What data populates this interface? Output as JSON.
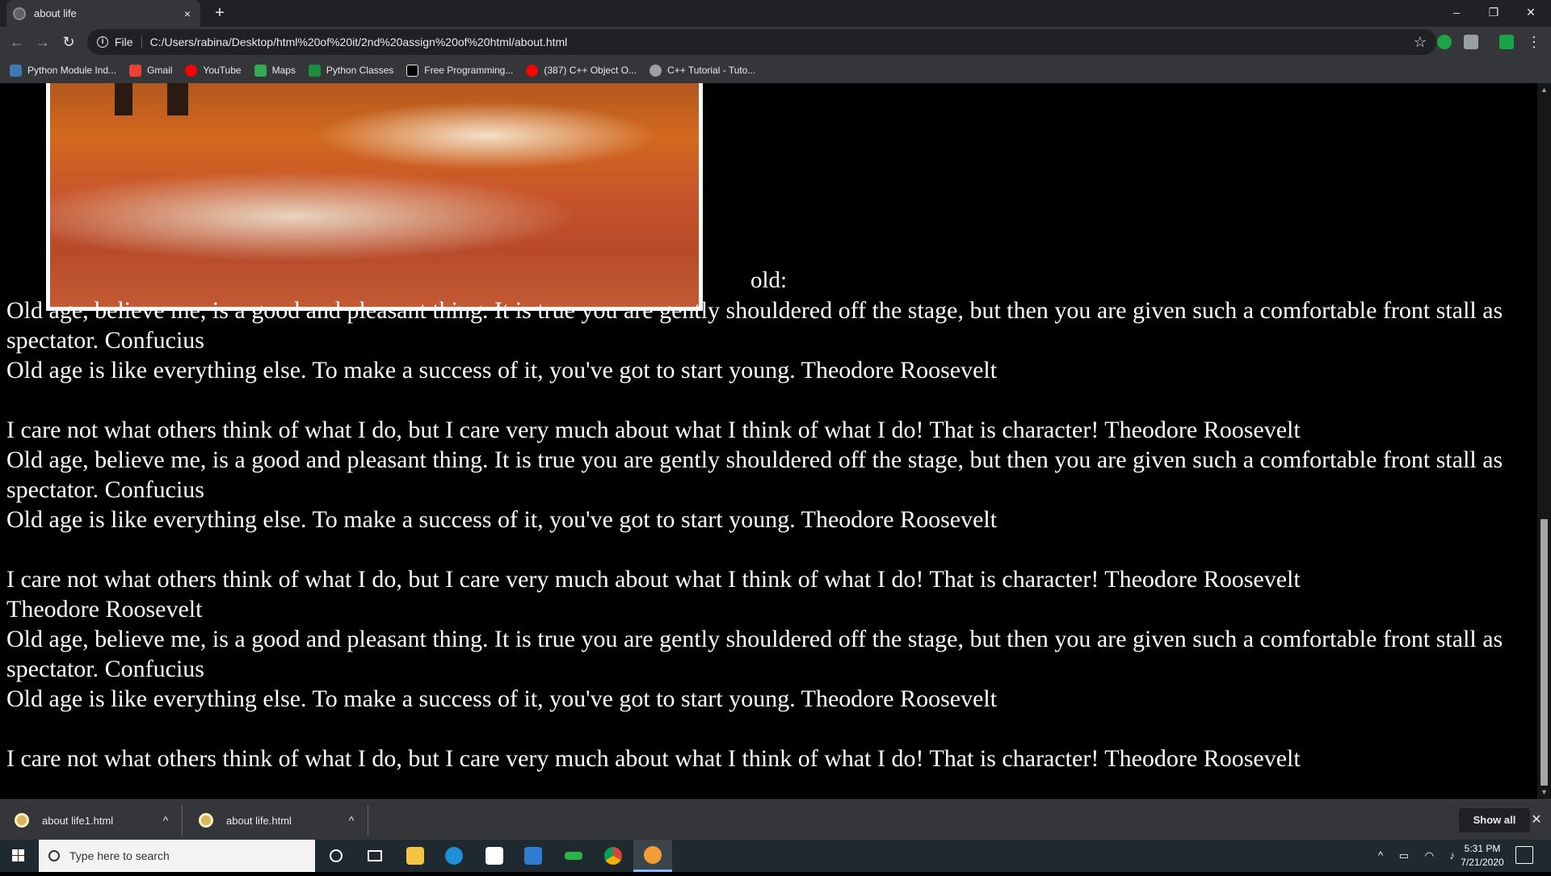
{
  "browser": {
    "tab_title": "about life",
    "tab_close": "×",
    "new_tab": "+",
    "window_controls": {
      "minimize": "–",
      "restore": "❐",
      "close": "✕"
    },
    "nav": {
      "back": "←",
      "forward": "→",
      "reload": "↻"
    },
    "omnibox": {
      "scheme_label": "File",
      "url": "C:/Users/rabina/Desktop/html%20of%20it/2nd%20assign%20of%20html/about.html",
      "bookmark_star": "☆"
    },
    "extensions": [
      {
        "name": "adblock-icon",
        "color": "#1ea446"
      },
      {
        "name": "drive-icon",
        "color": "#9aa0a6"
      },
      {
        "name": "shield-icon",
        "color": "#1aa34a"
      }
    ],
    "menu": "⋮"
  },
  "bookmarks": [
    {
      "label": "Python Module Ind...",
      "icon": "python-icon",
      "color": "#3d7ab7"
    },
    {
      "label": "Gmail",
      "icon": "gmail-icon",
      "color": "#ea4335"
    },
    {
      "label": "YouTube",
      "icon": "youtube-icon",
      "color": "#ff0000"
    },
    {
      "label": "Maps",
      "icon": "maps-icon",
      "color": "#34a853"
    },
    {
      "label": "Python Classes",
      "icon": "classroom-icon",
      "color": "#1e8e3e"
    },
    {
      "label": "Free Programming...",
      "icon": "l-icon",
      "color": "#000000"
    },
    {
      "label": "(387) C++ Object O...",
      "icon": "youtube-icon",
      "color": "#ff0000"
    },
    {
      "label": "C++ Tutorial - Tuto...",
      "icon": "gear-icon",
      "color": "#9aa0a6"
    }
  ],
  "page": {
    "heading": "old:",
    "quotes": [
      "Old age, believe me, is a good and pleasant thing. It is true you are gently shouldered off the stage, but then you are given such a comfortable front stall as spectator. Confucius",
      "Old age is like everything else. To make a success of it, you've got to start young. Theodore Roosevelt",
      "",
      "I care not what others think of what I do, but I care very much about what I think of what I do! That is character! Theodore Roosevelt",
      "Old age, believe me, is a good and pleasant thing. It is true you are gently shouldered off the stage, but then you are given such a comfortable front stall as spectator. Confucius",
      "Old age is like everything else. To make a success of it, you've got to start young. Theodore Roosevelt",
      "",
      "I care not what others think of what I do, but I care very much about what I think of what I do! That is character! Theodore Roosevelt",
      "Theodore Roosevelt",
      "Old age, believe me, is a good and pleasant thing. It is true you are gently shouldered off the stage, but then you are given such a comfortable front stall as spectator. Confucius",
      "Old age is like everything else. To make a success of it, you've got to start young. Theodore Roosevelt",
      "",
      "I care not what others think of what I do, but I care very much about what I think of what I do! That is character! Theodore Roosevelt"
    ]
  },
  "downloads": {
    "items": [
      {
        "name": "about life1.html"
      },
      {
        "name": "about life.html"
      }
    ],
    "caret": "^",
    "show_all": "Show all",
    "close": "✕"
  },
  "taskbar": {
    "search_placeholder": "Type here to search",
    "apps": [
      {
        "name": "cortana-icon",
        "color": "#ffffff"
      },
      {
        "name": "task-view-icon",
        "color": "#ffffff"
      },
      {
        "name": "file-explorer-icon",
        "color": "#f4c542"
      },
      {
        "name": "edge-icon",
        "color": "#1e90d6"
      },
      {
        "name": "store-icon",
        "color": "#ffffff"
      },
      {
        "name": "mail-icon",
        "color": "#2f7dd1"
      },
      {
        "name": "app-icon",
        "color": "#2bb34a"
      },
      {
        "name": "chrome-icon",
        "color": "#db4437"
      },
      {
        "name": "brave-icon",
        "color": "#f29d38"
      }
    ],
    "time": "5:31 PM",
    "date": "7/21/2020"
  }
}
